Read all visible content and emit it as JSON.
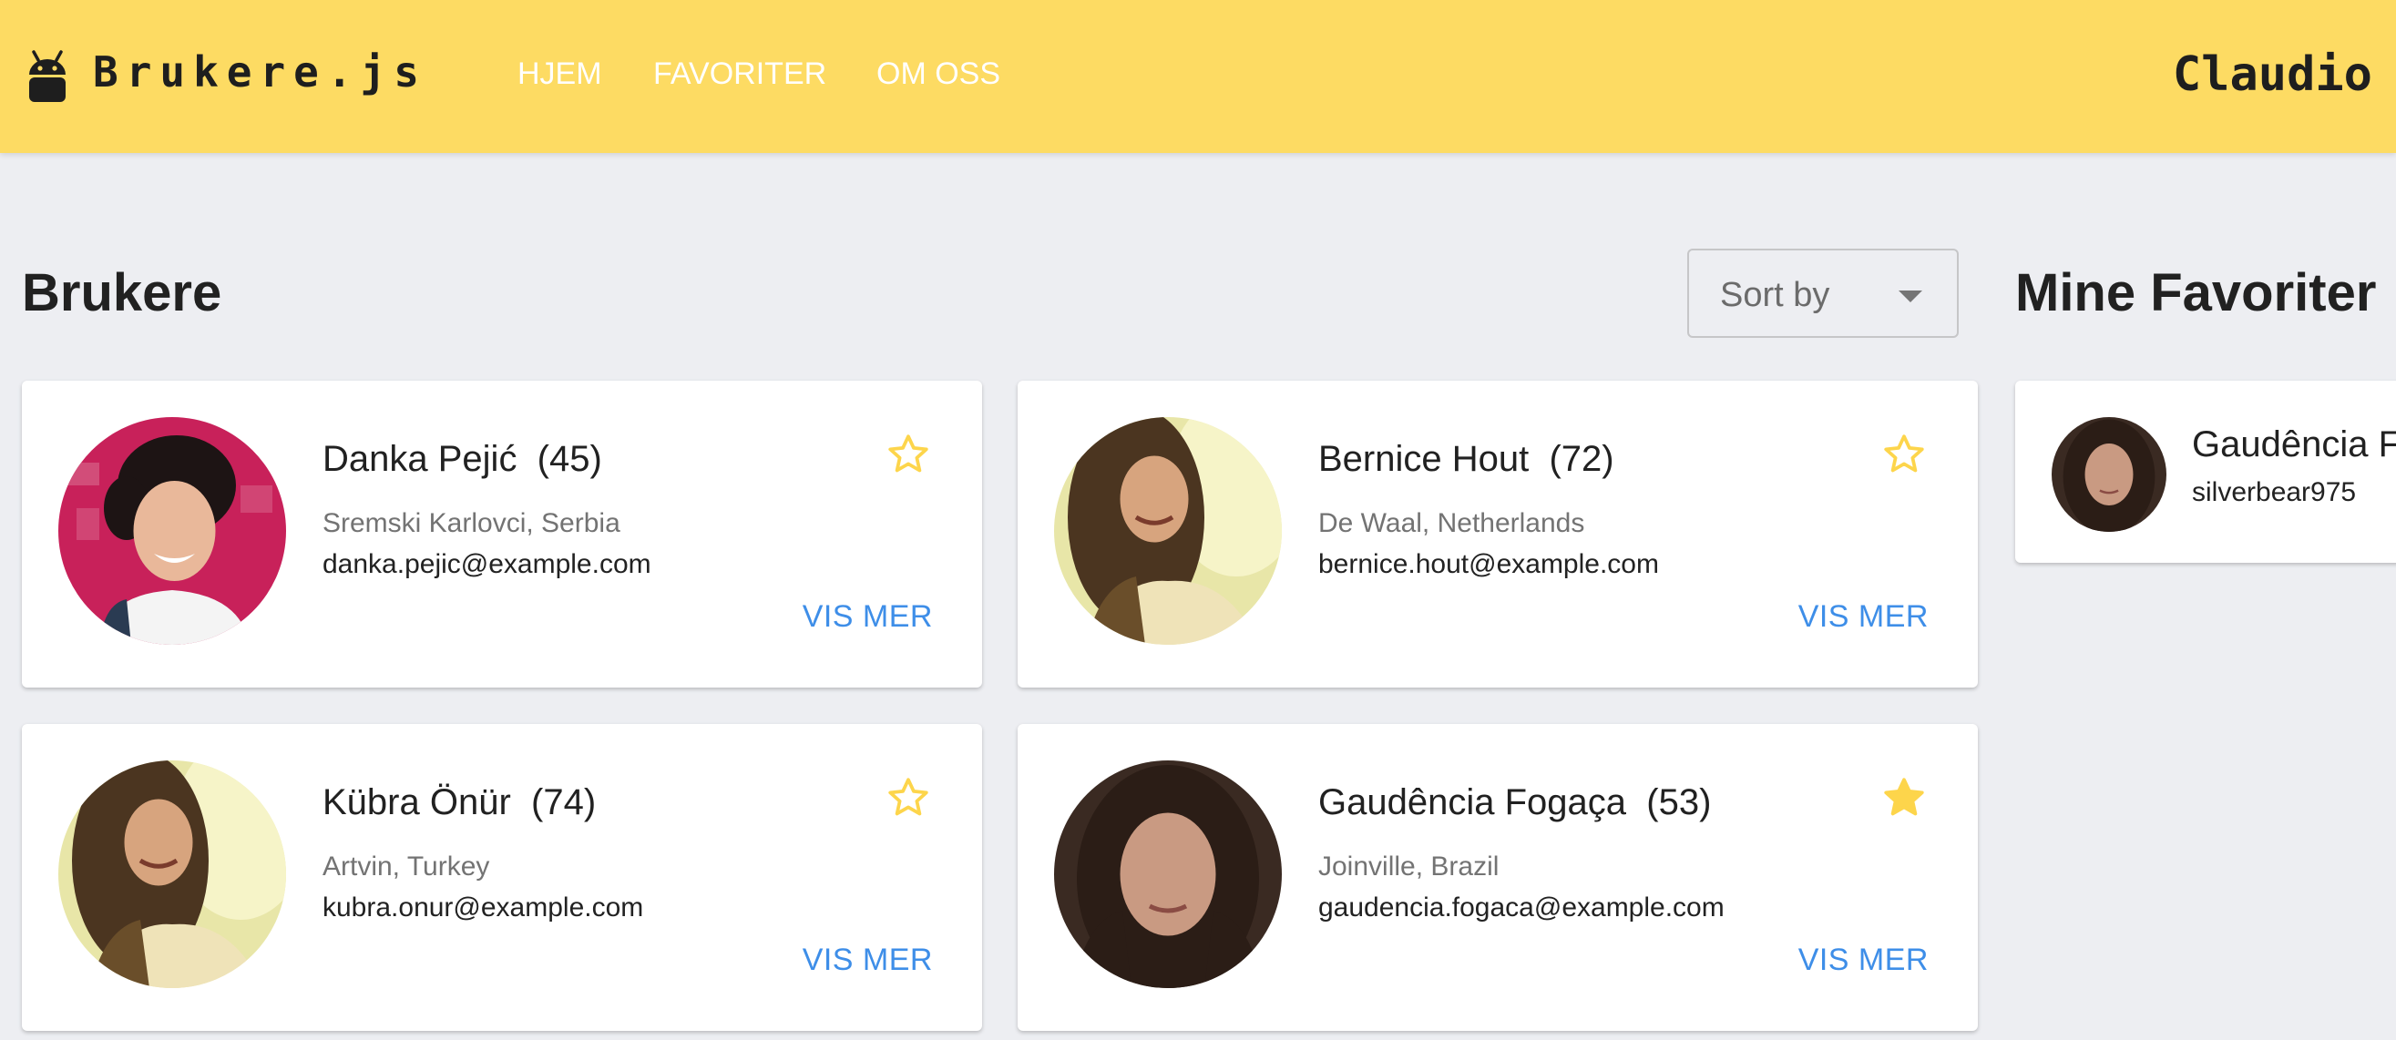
{
  "app": {
    "brand": "Brukere.js",
    "logo_icon": "android-icon",
    "accent_color": "#fddb63",
    "link_color": "#3e8ee8",
    "star_color": "#fdd54b"
  },
  "nav": {
    "items": [
      {
        "label": "HJEM"
      },
      {
        "label": "FAVORITER"
      },
      {
        "label": "OM OSS"
      }
    ],
    "user": "Claudio"
  },
  "users_section": {
    "title": "Brukere",
    "sort_placeholder": "Sort by",
    "cards": [
      {
        "name": "Danka Pejić",
        "age_label": "(45)",
        "location": "Sremski Karlovci, Serbia",
        "email": "danka.pejic@example.com",
        "favorite": false,
        "action": "VIS MER"
      },
      {
        "name": "Bernice Hout",
        "age_label": "(72)",
        "location": "De Waal, Netherlands",
        "email": "bernice.hout@example.com",
        "favorite": false,
        "action": "VIS MER"
      },
      {
        "name": "Kübra Önür",
        "age_label": "(74)",
        "location": "Artvin, Turkey",
        "email": "kubra.onur@example.com",
        "favorite": false,
        "action": "VIS MER"
      },
      {
        "name": "Gaudência Fogaça",
        "age_label": "(53)",
        "location": "Joinville, Brazil",
        "email": "gaudencia.fogaca@example.com",
        "favorite": true,
        "action": "VIS MER"
      }
    ]
  },
  "favorites_section": {
    "title": "Mine Favoriter",
    "items": [
      {
        "name": "Gaudência F",
        "username": "silverbear975"
      }
    ]
  }
}
